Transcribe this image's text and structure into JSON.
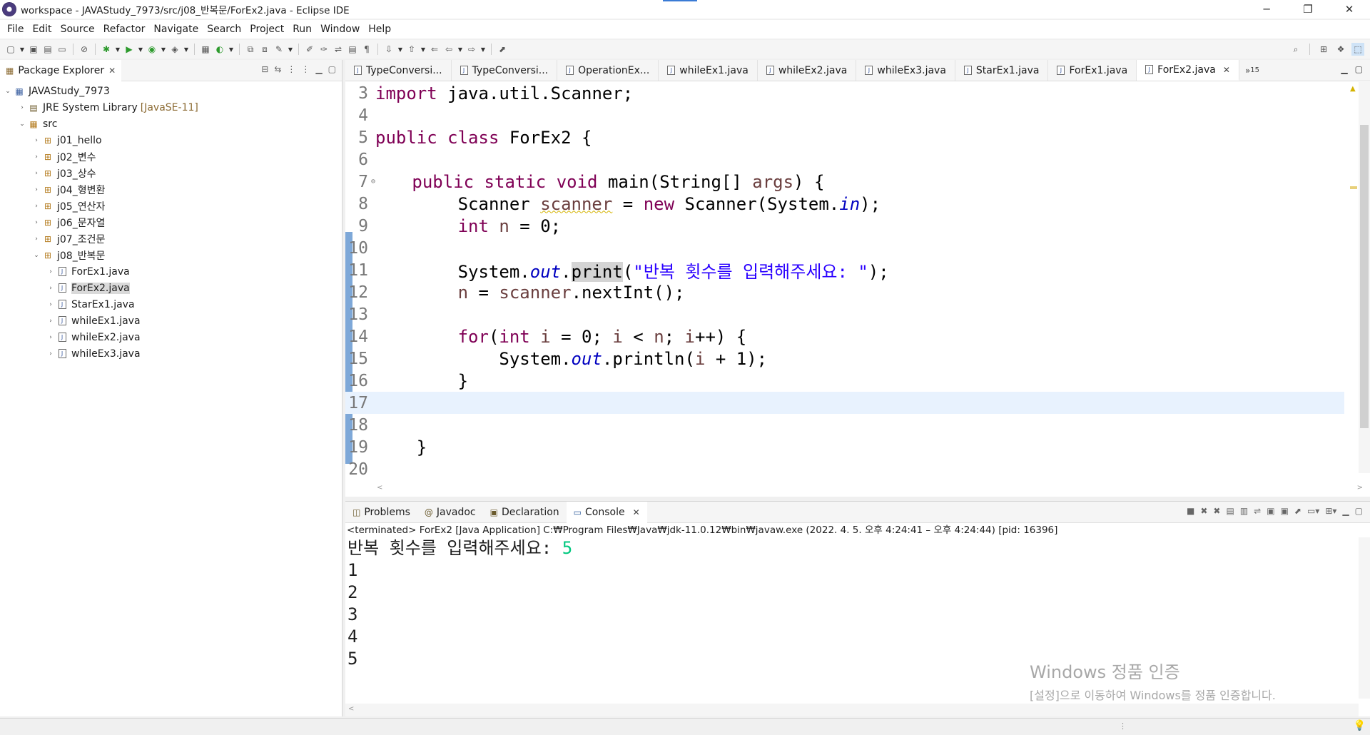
{
  "window": {
    "title": "workspace - JAVAStudy_7973/src/j08_반복문/ForEx2.java - Eclipse IDE",
    "minimize": "─",
    "maximize": "❐",
    "close": "✕"
  },
  "menu": [
    "File",
    "Edit",
    "Source",
    "Refactor",
    "Navigate",
    "Search",
    "Project",
    "Run",
    "Window",
    "Help"
  ],
  "explorer": {
    "tab_label": "Package Explorer",
    "tree": [
      {
        "label": "JAVAStudy_7973",
        "level": 0,
        "expanded": true,
        "type": "project"
      },
      {
        "label": "JRE System Library",
        "decoration": "[JavaSE-11]",
        "level": 1,
        "expanded": false,
        "type": "library"
      },
      {
        "label": "src",
        "level": 1,
        "expanded": true,
        "type": "folder"
      },
      {
        "label": "j01_hello",
        "level": 2,
        "expanded": false,
        "type": "package"
      },
      {
        "label": "j02_변수",
        "level": 2,
        "expanded": false,
        "type": "package"
      },
      {
        "label": "j03_상수",
        "level": 2,
        "expanded": false,
        "type": "package"
      },
      {
        "label": "j04_형변환",
        "level": 2,
        "expanded": false,
        "type": "package"
      },
      {
        "label": "j05_연산자",
        "level": 2,
        "expanded": false,
        "type": "package"
      },
      {
        "label": "j06_문자열",
        "level": 2,
        "expanded": false,
        "type": "package"
      },
      {
        "label": "j07_조건문",
        "level": 2,
        "expanded": false,
        "type": "package"
      },
      {
        "label": "j08_반복문",
        "level": 2,
        "expanded": true,
        "type": "package"
      },
      {
        "label": "ForEx1.java",
        "level": 3,
        "expanded": false,
        "type": "file"
      },
      {
        "label": "ForEx2.java",
        "level": 3,
        "expanded": false,
        "type": "file",
        "selected": true
      },
      {
        "label": "StarEx1.java",
        "level": 3,
        "expanded": false,
        "type": "file"
      },
      {
        "label": "whileEx1.java",
        "level": 3,
        "expanded": false,
        "type": "file"
      },
      {
        "label": "whileEx2.java",
        "level": 3,
        "expanded": false,
        "type": "file"
      },
      {
        "label": "whileEx3.java",
        "level": 3,
        "expanded": false,
        "type": "file"
      }
    ]
  },
  "editor": {
    "tabs": [
      "TypeConversi...",
      "TypeConversi...",
      "OperationEx...",
      "whileEx1.java",
      "whileEx2.java",
      "whileEx3.java",
      "StarEx1.java",
      "ForEx1.java",
      "ForEx2.java"
    ],
    "active_tab": "ForEx2.java",
    "overflow_label": "»",
    "overflow_count": "15",
    "current_line": "17"
  },
  "console": {
    "tabs": [
      "Problems",
      "Javadoc",
      "Declaration",
      "Console"
    ],
    "active_tab": "Console",
    "status": "<terminated> ForEx2 [Java Application] C:₩Program Files₩Java₩jdk-11.0.12₩bin₩javaw.exe  (2022. 4. 5. 오후 4:24:41 – 오후 4:24:44) [pid: 16396]",
    "prompt": "반복 횟수를 입력해주세요: ",
    "input": "5",
    "output": [
      "1",
      "2",
      "3",
      "4",
      "5"
    ]
  },
  "watermark": {
    "title": "Windows 정품 인증",
    "subtitle": "[설정]으로 이동하여 Windows를 정품 인증합니다."
  }
}
